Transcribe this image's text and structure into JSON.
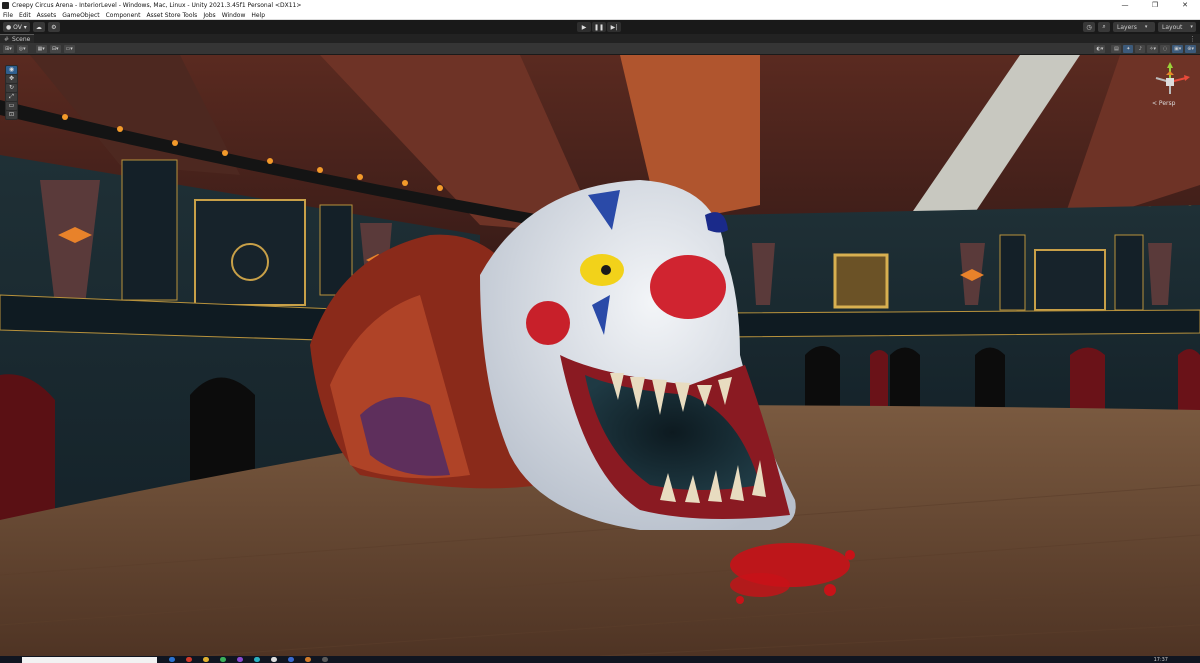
{
  "window": {
    "title": "Creepy Circus Arena - InteriorLevel - Windows, Mac, Linux - Unity 2021.3.45f1 Personal <DX11>",
    "controls": [
      "—",
      "❐",
      "✕"
    ]
  },
  "menu": [
    "File",
    "Edit",
    "Assets",
    "GameObject",
    "Component",
    "Asset Store Tools",
    "Jobs",
    "Window",
    "Help"
  ],
  "toolbar": {
    "account_label": "OV",
    "cloud_icon": "cloud-icon",
    "collab_icon": "gear-icon",
    "play_icon": "▶",
    "pause_icon": "❚❚",
    "step_icon": "▶|",
    "history_icon": "history-icon",
    "search_icon": "search-icon",
    "layers_label": "Layers",
    "layout_label": "Layout"
  },
  "scene_tab": {
    "label": "Scene",
    "menu_icon": "⋮"
  },
  "scene_view": {
    "camera_label": "< Persp",
    "tools": [
      "view-tool",
      "move-tool",
      "rotate-tool",
      "scale-tool",
      "rect-tool",
      "transform-tool"
    ]
  },
  "colors": {
    "tent_red": "#7a2e22",
    "floor": "#6b4a33",
    "clown_white": "#dfe4ec",
    "clown_red": "#c8202a",
    "clown_blue": "#2a4aa8",
    "eye_yellow": "#f2d21a",
    "accent_blue": "#3c7fd0"
  },
  "taskbar": {
    "clock": "17:37"
  }
}
